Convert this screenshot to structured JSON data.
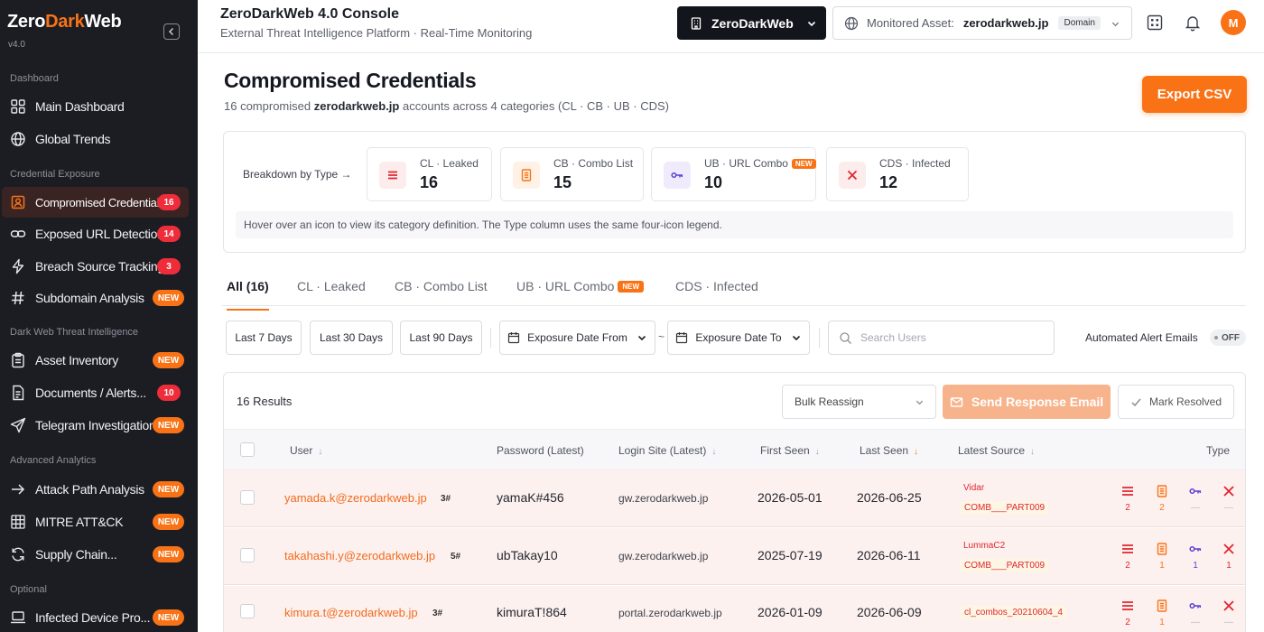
{
  "app": {
    "logo_pre": "Zero",
    "logo_accent": "Dark",
    "logo_post": "Web",
    "version": "v4.0",
    "title": "ZeroDarkWeb 4.0 Console",
    "subtitle": "External Threat Intelligence Platform · Real-Time Monitoring"
  },
  "colors": {
    "accent": "#f97316",
    "sidebar_bg": "#1b1d23",
    "danger": "#ef2d3a",
    "url_combo": "#5b3fd1"
  },
  "sidebar": {
    "sections": [
      {
        "label": "Dashboard",
        "items": [
          {
            "label": "Main Dashboard",
            "icon": "grid-icon"
          },
          {
            "label": "Global Trends",
            "icon": "globe-icon"
          }
        ]
      },
      {
        "label": "Credential Exposure",
        "items": [
          {
            "label": "Compromised Credentials",
            "icon": "user-badge-icon",
            "count": "16",
            "active": true
          },
          {
            "label": "Exposed URL Detection",
            "icon": "link-icon",
            "count": "14"
          },
          {
            "label": "Breach Source Tracking",
            "icon": "bolt-icon",
            "count": "3"
          },
          {
            "label": "Subdomain Analysis",
            "icon": "hash-icon",
            "badge": "NEW"
          }
        ]
      },
      {
        "label": "Dark Web Threat Intelligence",
        "items": [
          {
            "label": "Asset Inventory",
            "icon": "clipboard-icon",
            "badge": "NEW"
          },
          {
            "label": "Documents / Alerts...",
            "icon": "document-icon",
            "count": "10"
          },
          {
            "label": "Telegram Investigation",
            "icon": "send-icon",
            "badge": "NEW"
          }
        ]
      },
      {
        "label": "Advanced Analytics",
        "items": [
          {
            "label": "Attack Path Analysis",
            "icon": "arrow-right-icon",
            "badge": "NEW"
          },
          {
            "label": "MITRE ATT&CK",
            "icon": "matrix-icon",
            "badge": "NEW"
          },
          {
            "label": "Supply Chain...",
            "icon": "refresh-icon",
            "badge": "NEW"
          }
        ]
      },
      {
        "label": "Optional",
        "items": [
          {
            "label": "Infected Device Pro...",
            "icon": "laptop-icon",
            "badge": "NEW"
          }
        ]
      }
    ]
  },
  "header": {
    "org_name": "ZeroDarkWeb",
    "asset_label": "Monitored Asset:",
    "asset_value": "zerodarkweb.jp",
    "asset_type": "Domain",
    "avatar_initial": "M"
  },
  "page": {
    "title": "Compromised Credentials",
    "subtitle_count": "16",
    "subtitle_mid": " compromised ",
    "subtitle_domain": "zerodarkweb.jp",
    "subtitle_tail": " accounts across 4 categories (CL · CB · UB · CDS)",
    "export_label": "Export CSV"
  },
  "breakdown": {
    "label": "Breakdown by Type →",
    "items": [
      {
        "name": "CL · Leaked",
        "count": "16"
      },
      {
        "name": "CB · Combo List",
        "count": "15"
      },
      {
        "name": "UB · URL Combo",
        "count": "10",
        "badge": "NEW"
      },
      {
        "name": "CDS · Infected",
        "count": "12"
      }
    ],
    "hint": "Hover over an icon to view its category definition. The Type column uses the same four-icon legend."
  },
  "tabs": [
    {
      "label": "All (16)",
      "active": true
    },
    {
      "label": "CL · Leaked"
    },
    {
      "label": "CB · Combo List"
    },
    {
      "label": "UB · URL Combo",
      "badge": "NEW"
    },
    {
      "label": "CDS · Infected"
    }
  ],
  "filters": {
    "last7": "Last 7 Days",
    "last30": "Last 30 Days",
    "last90": "Last 90 Days",
    "date_from": "Exposure Date From",
    "date_to": "Exposure Date To",
    "tilde": "~",
    "search_placeholder": "Search Users",
    "alert_label": "Automated Alert Emails",
    "alert_state": "OFF"
  },
  "results": {
    "count_label": "16 Results",
    "bulk_label": "Bulk Reassign",
    "send_label": "Send Response Email",
    "resolve_label": "Mark Resolved"
  },
  "table": {
    "columns": {
      "user": "User",
      "password": "Password (Latest)",
      "login_site": "Login Site (Latest)",
      "first_seen": "First Seen",
      "last_seen": "Last Seen",
      "latest_source": "Latest Source",
      "type": "Type"
    },
    "rows": [
      {
        "user": "yamada.k@zerodarkweb.jp",
        "count": "3#",
        "password": "yamaK#456",
        "site": "gw.zerodarkweb.jp",
        "first_seen": "2026-05-01",
        "last_seen": "2026-06-25",
        "source_name": "Vidar",
        "source_file": "COMB___PART009",
        "types": [
          "2",
          "2",
          "—",
          "—"
        ]
      },
      {
        "user": "takahashi.y@zerodarkweb.jp",
        "count": "5#",
        "password": "ubTakay10",
        "site": "gw.zerodarkweb.jp",
        "first_seen": "2025-07-19",
        "last_seen": "2026-06-11",
        "source_name": "LummaC2",
        "source_file": "COMB___PART009",
        "types": [
          "2",
          "1",
          "1",
          "1"
        ]
      },
      {
        "user": "kimura.t@zerodarkweb.jp",
        "count": "3#",
        "password": "kimuraT!864",
        "site": "portal.zerodarkweb.jp",
        "first_seen": "2026-01-09",
        "last_seen": "2026-06-09",
        "source_name": "",
        "source_file": "cl_combos_20210604_4",
        "types": [
          "2",
          "1",
          "—",
          "—"
        ]
      }
    ]
  }
}
